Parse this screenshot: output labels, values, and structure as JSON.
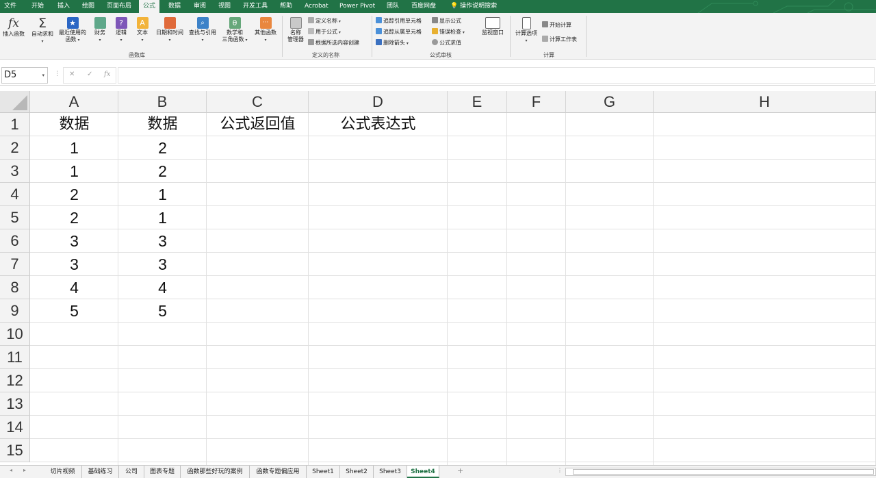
{
  "menu": {
    "tabs": [
      "文件",
      "开始",
      "插入",
      "绘图",
      "页面布局",
      "公式",
      "数据",
      "审阅",
      "视图",
      "开发工具",
      "帮助",
      "Acrobat",
      "Power Pivot",
      "团队",
      "百度网盘"
    ],
    "active": "公式",
    "tell_me": "操作说明搜索"
  },
  "ribbon": {
    "insert_function": "插入函数",
    "autosum": "自动求和",
    "recent_line1": "最近使用的",
    "recent_line2": "函数",
    "finance": "财务",
    "logic": "逻辑",
    "text": "文本",
    "datetime": "日期和时间",
    "lookup": "查找与引用",
    "math_line1": "数学和",
    "math_line2": "三角函数",
    "other": "其他函数",
    "group_library": "函数库",
    "name_mgr_line1": "名称",
    "name_mgr_line2": "管理器",
    "define_name": "定义名称",
    "use_in_formula": "用于公式",
    "create_from_sel": "根据所选内容创建",
    "group_names": "定义的名称",
    "trace_precedents": "追踪引用单元格",
    "trace_dependents": "追踪从属单元格",
    "remove_arrows": "删除箭头",
    "show_formulas": "显示公式",
    "error_check": "错误检查",
    "eval_formula": "公式求值",
    "group_audit": "公式审核",
    "watch_window": "监视窗口",
    "calc_options": "计算选项",
    "calc_now": "开始计算",
    "calc_sheet": "计算工作表",
    "group_calc": "计算"
  },
  "formula_bar": {
    "name_box": "D5",
    "cancel_glyph": "✕",
    "enter_glyph": "✓",
    "fx_glyph": "fx",
    "formula": ""
  },
  "grid": {
    "columns": [
      "A",
      "B",
      "C",
      "D",
      "E",
      "F",
      "G",
      "H"
    ],
    "rows": [
      "1",
      "2",
      "3",
      "4",
      "5",
      "6",
      "7",
      "8",
      "9",
      "10",
      "11",
      "12",
      "13",
      "14",
      "15"
    ],
    "cells": {
      "A1": "数据",
      "B1": "数据",
      "C1": "公式返回值",
      "D1": "公式表达式",
      "A2": "1",
      "B2": "2",
      "A3": "1",
      "B3": "2",
      "A4": "2",
      "B4": "1",
      "A5": "2",
      "B5": "1",
      "A6": "3",
      "B6": "3",
      "A7": "3",
      "B7": "3",
      "A8": "4",
      "B8": "4",
      "A9": "5",
      "B9": "5"
    }
  },
  "sheets": {
    "tabs": [
      "切片视频",
      "基础练习",
      "公司",
      "图表专题",
      "函数那些好玩的案例",
      "函数专题偏应用",
      "Sheet1",
      "Sheet2",
      "Sheet3",
      "Sheet4"
    ],
    "active": "Sheet4",
    "add_glyph": "+"
  },
  "colors": {
    "brand": "#217346",
    "ribbon_bg": "#f3f3f3",
    "header_bg": "#f3f3f3"
  }
}
